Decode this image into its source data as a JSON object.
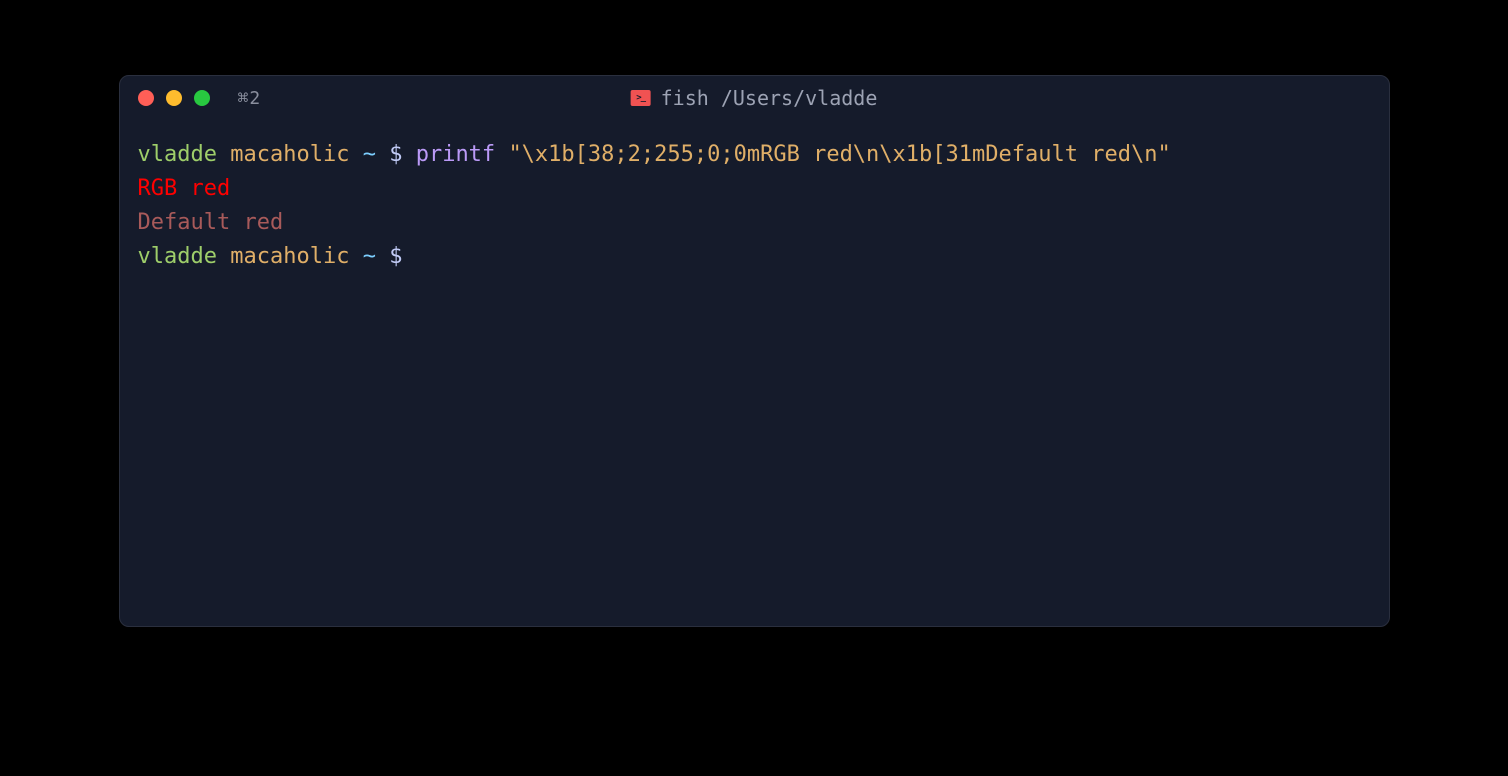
{
  "titlebar": {
    "tab_indicator": "⌘2",
    "title": "fish /Users/vladde"
  },
  "colors": {
    "traffic_red": "#ff5f57",
    "traffic_yellow": "#febc2e",
    "traffic_green": "#28c840",
    "bg": "#151b2b",
    "prompt_user": "#9ece6a",
    "prompt_host": "#e0af68",
    "prompt_tilde": "#7dcfff",
    "prompt_dollar": "#c0caf5",
    "command": "#bb9af7",
    "string": "#e0af68",
    "rgb_red": "#ff0000",
    "default_red": "#a85a5a"
  },
  "terminal": {
    "lines": [
      {
        "segments": [
          {
            "text": "vladde",
            "class": "c-green"
          },
          {
            "text": " ",
            "class": "c-white"
          },
          {
            "text": "macaholic",
            "class": "c-yellow"
          },
          {
            "text": " ",
            "class": "c-white"
          },
          {
            "text": "~",
            "class": "c-cyan"
          },
          {
            "text": " ",
            "class": "c-white"
          },
          {
            "text": "$",
            "class": "c-white"
          },
          {
            "text": " ",
            "class": "c-white"
          },
          {
            "text": "printf",
            "class": "c-purple"
          },
          {
            "text": " ",
            "class": "c-white"
          },
          {
            "text": "\"\\x1b[38;2;255;0;0mRGB red\\n\\x1b[31mDefault red\\n\"",
            "class": "c-yellow"
          }
        ]
      },
      {
        "segments": [
          {
            "text": "RGB red",
            "class": "c-rgb-red"
          }
        ]
      },
      {
        "segments": [
          {
            "text": "Default red",
            "class": "c-default-red"
          }
        ]
      },
      {
        "segments": [
          {
            "text": "vladde",
            "class": "c-green"
          },
          {
            "text": " ",
            "class": "c-white"
          },
          {
            "text": "macaholic",
            "class": "c-yellow"
          },
          {
            "text": " ",
            "class": "c-white"
          },
          {
            "text": "~",
            "class": "c-cyan"
          },
          {
            "text": " ",
            "class": "c-white"
          },
          {
            "text": "$",
            "class": "c-white"
          }
        ]
      }
    ]
  }
}
